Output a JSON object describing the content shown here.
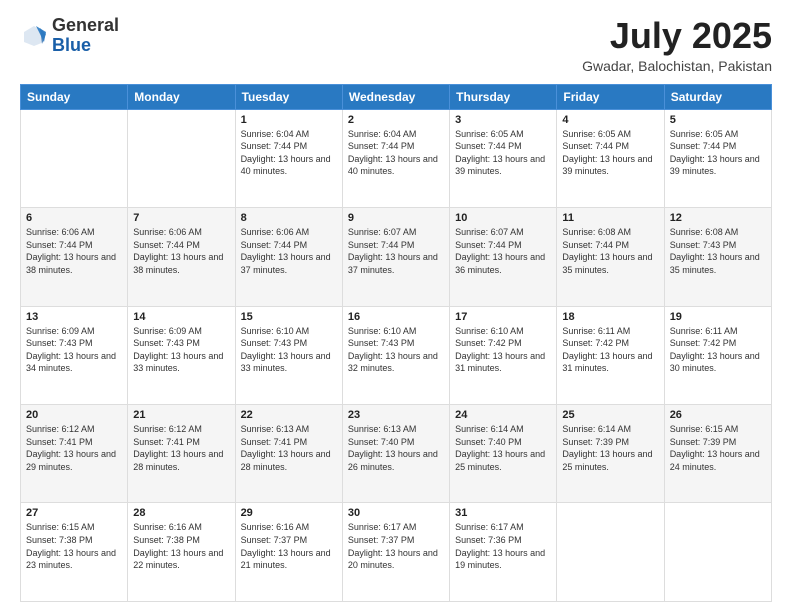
{
  "header": {
    "logo_general": "General",
    "logo_blue": "Blue",
    "main_title": "July 2025",
    "subtitle": "Gwadar, Balochistan, Pakistan"
  },
  "weekdays": [
    "Sunday",
    "Monday",
    "Tuesday",
    "Wednesday",
    "Thursday",
    "Friday",
    "Saturday"
  ],
  "weeks": [
    [
      {
        "day": "",
        "info": ""
      },
      {
        "day": "",
        "info": ""
      },
      {
        "day": "1",
        "info": "Sunrise: 6:04 AM\nSunset: 7:44 PM\nDaylight: 13 hours and 40 minutes."
      },
      {
        "day": "2",
        "info": "Sunrise: 6:04 AM\nSunset: 7:44 PM\nDaylight: 13 hours and 40 minutes."
      },
      {
        "day": "3",
        "info": "Sunrise: 6:05 AM\nSunset: 7:44 PM\nDaylight: 13 hours and 39 minutes."
      },
      {
        "day": "4",
        "info": "Sunrise: 6:05 AM\nSunset: 7:44 PM\nDaylight: 13 hours and 39 minutes."
      },
      {
        "day": "5",
        "info": "Sunrise: 6:05 AM\nSunset: 7:44 PM\nDaylight: 13 hours and 39 minutes."
      }
    ],
    [
      {
        "day": "6",
        "info": "Sunrise: 6:06 AM\nSunset: 7:44 PM\nDaylight: 13 hours and 38 minutes."
      },
      {
        "day": "7",
        "info": "Sunrise: 6:06 AM\nSunset: 7:44 PM\nDaylight: 13 hours and 38 minutes."
      },
      {
        "day": "8",
        "info": "Sunrise: 6:06 AM\nSunset: 7:44 PM\nDaylight: 13 hours and 37 minutes."
      },
      {
        "day": "9",
        "info": "Sunrise: 6:07 AM\nSunset: 7:44 PM\nDaylight: 13 hours and 37 minutes."
      },
      {
        "day": "10",
        "info": "Sunrise: 6:07 AM\nSunset: 7:44 PM\nDaylight: 13 hours and 36 minutes."
      },
      {
        "day": "11",
        "info": "Sunrise: 6:08 AM\nSunset: 7:44 PM\nDaylight: 13 hours and 35 minutes."
      },
      {
        "day": "12",
        "info": "Sunrise: 6:08 AM\nSunset: 7:43 PM\nDaylight: 13 hours and 35 minutes."
      }
    ],
    [
      {
        "day": "13",
        "info": "Sunrise: 6:09 AM\nSunset: 7:43 PM\nDaylight: 13 hours and 34 minutes."
      },
      {
        "day": "14",
        "info": "Sunrise: 6:09 AM\nSunset: 7:43 PM\nDaylight: 13 hours and 33 minutes."
      },
      {
        "day": "15",
        "info": "Sunrise: 6:10 AM\nSunset: 7:43 PM\nDaylight: 13 hours and 33 minutes."
      },
      {
        "day": "16",
        "info": "Sunrise: 6:10 AM\nSunset: 7:43 PM\nDaylight: 13 hours and 32 minutes."
      },
      {
        "day": "17",
        "info": "Sunrise: 6:10 AM\nSunset: 7:42 PM\nDaylight: 13 hours and 31 minutes."
      },
      {
        "day": "18",
        "info": "Sunrise: 6:11 AM\nSunset: 7:42 PM\nDaylight: 13 hours and 31 minutes."
      },
      {
        "day": "19",
        "info": "Sunrise: 6:11 AM\nSunset: 7:42 PM\nDaylight: 13 hours and 30 minutes."
      }
    ],
    [
      {
        "day": "20",
        "info": "Sunrise: 6:12 AM\nSunset: 7:41 PM\nDaylight: 13 hours and 29 minutes."
      },
      {
        "day": "21",
        "info": "Sunrise: 6:12 AM\nSunset: 7:41 PM\nDaylight: 13 hours and 28 minutes."
      },
      {
        "day": "22",
        "info": "Sunrise: 6:13 AM\nSunset: 7:41 PM\nDaylight: 13 hours and 28 minutes."
      },
      {
        "day": "23",
        "info": "Sunrise: 6:13 AM\nSunset: 7:40 PM\nDaylight: 13 hours and 26 minutes."
      },
      {
        "day": "24",
        "info": "Sunrise: 6:14 AM\nSunset: 7:40 PM\nDaylight: 13 hours and 25 minutes."
      },
      {
        "day": "25",
        "info": "Sunrise: 6:14 AM\nSunset: 7:39 PM\nDaylight: 13 hours and 25 minutes."
      },
      {
        "day": "26",
        "info": "Sunrise: 6:15 AM\nSunset: 7:39 PM\nDaylight: 13 hours and 24 minutes."
      }
    ],
    [
      {
        "day": "27",
        "info": "Sunrise: 6:15 AM\nSunset: 7:38 PM\nDaylight: 13 hours and 23 minutes."
      },
      {
        "day": "28",
        "info": "Sunrise: 6:16 AM\nSunset: 7:38 PM\nDaylight: 13 hours and 22 minutes."
      },
      {
        "day": "29",
        "info": "Sunrise: 6:16 AM\nSunset: 7:37 PM\nDaylight: 13 hours and 21 minutes."
      },
      {
        "day": "30",
        "info": "Sunrise: 6:17 AM\nSunset: 7:37 PM\nDaylight: 13 hours and 20 minutes."
      },
      {
        "day": "31",
        "info": "Sunrise: 6:17 AM\nSunset: 7:36 PM\nDaylight: 13 hours and 19 minutes."
      },
      {
        "day": "",
        "info": ""
      },
      {
        "day": "",
        "info": ""
      }
    ]
  ]
}
